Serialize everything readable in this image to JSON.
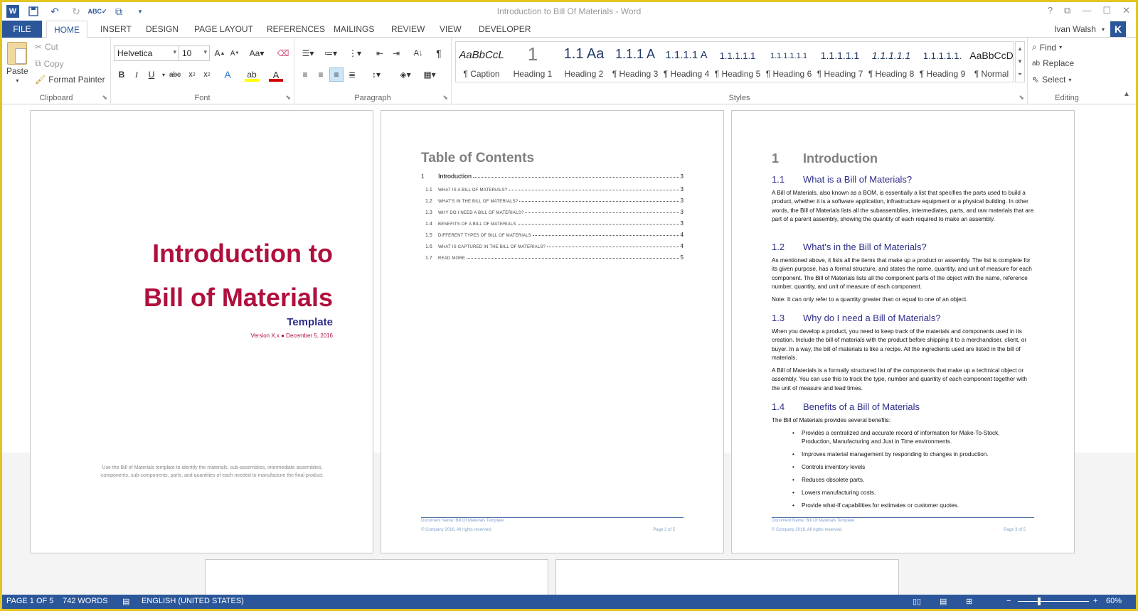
{
  "window": {
    "title": "Introduction to Bill Of Materials - Word",
    "controls": [
      "?",
      "⧉",
      "—",
      "☐",
      "✕"
    ]
  },
  "qat": {
    "icons": [
      "word-logo",
      "save-icon",
      "undo-icon",
      "redo-icon",
      "spelling-icon",
      "touch-mode-icon",
      "customize-icon"
    ]
  },
  "tabs": [
    "FILE",
    "HOME",
    "INSERT",
    "DESIGN",
    "PAGE LAYOUT",
    "REFERENCES",
    "MAILINGS",
    "REVIEW",
    "VIEW",
    "DEVELOPER"
  ],
  "user": {
    "name": "Ivan Walsh",
    "initial": "K"
  },
  "ribbon": {
    "clipboard": {
      "paste": "Paste",
      "cut": "Cut",
      "copy": "Copy",
      "format_painter": "Format Painter",
      "label": "Clipboard"
    },
    "font": {
      "name": "Helvetica",
      "size": "10",
      "label": "Font"
    },
    "paragraph": {
      "label": "Paragraph"
    },
    "styles": {
      "label": "Styles",
      "items": [
        {
          "sample": "AaBbCcL",
          "name": "¶ Caption"
        },
        {
          "sample": "1",
          "name": "Heading 1"
        },
        {
          "sample": "1.1 Aa",
          "name": "Heading 2"
        },
        {
          "sample": "1.1.1 A",
          "name": "¶ Heading 3"
        },
        {
          "sample": "1.1.1.1 A",
          "name": "¶ Heading 4"
        },
        {
          "sample": "1.1.1.1.1",
          "name": "¶ Heading 5"
        },
        {
          "sample": "1.1.1.1.1.1",
          "name": "¶ Heading 6"
        },
        {
          "sample": "1.1.1.1.1",
          "name": "¶ Heading 7"
        },
        {
          "sample": "1.1.1.1.1",
          "name": "¶ Heading 8"
        },
        {
          "sample": "1.1.1.1.1.",
          "name": "¶ Heading 9"
        },
        {
          "sample": "AaBbCcD",
          "name": "¶ Normal"
        }
      ]
    },
    "editing": {
      "find": "Find",
      "replace": "Replace",
      "select": "Select",
      "label": "Editing"
    }
  },
  "pages": {
    "cover": {
      "title_line1": "Introduction to",
      "title_line2": "Bill of Materials",
      "subtitle": "Template",
      "version": "Version X.x ● December 5, 2016",
      "footer": "Use the Bill of Materials template to identify the materials, sub-assemblies, intermediate assemblies, components, sub-components, parts, and quantities of each needed to manufacture the final product."
    },
    "toc": {
      "title": "Table of Contents",
      "entries": [
        {
          "num": "1",
          "text": "Introduction",
          "page": "3"
        },
        {
          "num": "1.1",
          "text": "What is a Bill of Materials?",
          "page": "3"
        },
        {
          "num": "1.2",
          "text": "What's in the Bill of Materials?",
          "page": "3"
        },
        {
          "num": "1.3",
          "text": "Why do I need a Bill of Materials?",
          "page": "3"
        },
        {
          "num": "1.4",
          "text": "Benefits of a Bill of Materials",
          "page": "3"
        },
        {
          "num": "1.5",
          "text": "Different Types of Bill of Materials",
          "page": "4"
        },
        {
          "num": "1.6",
          "text": "What is captured in the Bill of Materials?",
          "page": "4"
        },
        {
          "num": "1.7",
          "text": "Read More",
          "page": "5"
        }
      ],
      "footer_doc": "Document Name: Bill Of Materials Template",
      "footer_copy": "© Company 2016. All rights reserved.",
      "footer_page": "Page 2 of 5"
    },
    "intro": {
      "h1_num": "1",
      "h1": "Introduction",
      "s1_num": "1.1",
      "s1": "What is a Bill of Materials?",
      "p1": "A Bill of Materials, also known as a BOM, is essentially a list that specifies the parts used to build a product, whether it is a software application, infrastructure equipment or a physical building. In other words, the Bill of Materials lists all the subassemblies, intermediates, parts, and raw materials that are part of a parent assembly, showing the quantity of each required to make an assembly.",
      "s2_num": "1.2",
      "s2": "What's in the Bill of Materials?",
      "p2": "As mentioned above, it lists all the items that make up a product or assembly. The list is complete for its given purpose, has a formal structure, and states the name, quantity, and unit of measure for each component. The Bill of Materials lists all the component parts of the object with the name, reference number, quantity, and unit of measure of each component.",
      "p2b": "Note: It can only refer to a quantity greater than or equal to one of an object.",
      "s3_num": "1.3",
      "s3": "Why do I need a Bill of Materials?",
      "p3": "When you develop a product, you need to keep track of the materials and components used in its creation. Include the bill of materials with the product before shipping it to a merchandiser, client, or buyer.  In a way, the bill of materials is like a recipe. All the ingredients used are listed in the bill of materials.",
      "p3b": "A Bill of Materials is a formally structured list of the components that make up a technical object or assembly. You can use this to track the type, number and quantity of each component together with the unit of measure and lead times.",
      "s4_num": "1.4",
      "s4": "Benefits of a Bill of Materials",
      "p4": "The Bill of Materials provides several benefits:",
      "bullets": [
        "Provides a centralized and accurate record of information for Make-To-Stock, Production, Manufacturing and Just in Time environments.",
        "Improves material management by responding to changes in production.",
        "Controls inventory levels",
        "Reduces obsolete parts.",
        "Lowers manufacturing costs.",
        "Provide what-If capabilities for estimates or customer quotes."
      ],
      "footer_doc": "Document Name: Bill Of Materials Template",
      "footer_copy": "© Company 2016. All rights reserved.",
      "footer_page": "Page 3 of 5"
    }
  },
  "status": {
    "page": "PAGE 1 OF 5",
    "words": "742 WORDS",
    "language": "ENGLISH (UNITED STATES)",
    "zoom": "60%",
    "zoom_level_percent": 60
  },
  "colors": {
    "accent": "#2b579a",
    "title_red": "#b0103c",
    "heading_blue": "#2e2e8a",
    "border_yellow": "#e3c420"
  }
}
